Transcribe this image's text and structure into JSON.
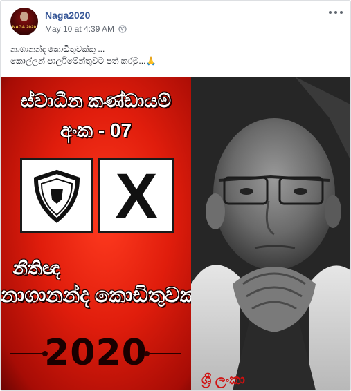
{
  "post": {
    "page_name": "Naga2020",
    "timestamp": "May 10 at 4:39 AM",
    "text_lines": [
      "නාගානන්ද කොඩිතුවක්කු ...",
      "කොල්ලන් පාර්ලිමේන්තුවට පත් කරමු..."
    ],
    "emoji": "🙏",
    "avatar_text": "NAGA 2020"
  },
  "poster": {
    "line1": "ස්වාධීන කණ්ඩායම්",
    "line2": "අංක - 07",
    "symbol_icon": "shield-icon",
    "mark": "X",
    "line3": "නීතිඥ",
    "line4": "නාගානන්ද කොඩිතුවක්කු",
    "year": "2020",
    "signature": "ශ්‍රී ලංකා"
  },
  "colors": {
    "name_link": "#385898",
    "poster_red": "#e01d0c",
    "text": "#1d2129",
    "muted": "#616770"
  }
}
